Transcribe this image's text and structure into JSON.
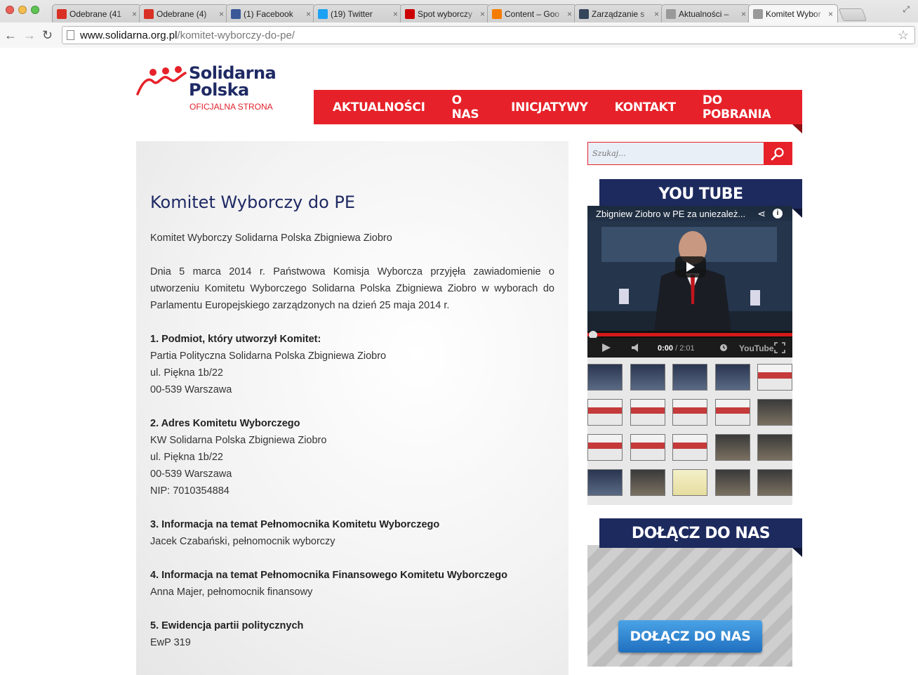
{
  "browser": {
    "tabs": [
      {
        "title": "Odebrane (41",
        "favicon": "gmail-icon",
        "color": "#d93025",
        "active": false
      },
      {
        "title": "Odebrane (4)",
        "favicon": "gmail-icon",
        "color": "#d93025",
        "active": false
      },
      {
        "title": "(1) Facebook",
        "favicon": "facebook-icon",
        "color": "#3b5998",
        "active": false
      },
      {
        "title": "(19) Twitter",
        "favicon": "twitter-icon",
        "color": "#1da1f2",
        "active": false
      },
      {
        "title": "Spot wyborczy",
        "favicon": "youtube-icon",
        "color": "#cc0000",
        "active": false
      },
      {
        "title": "Content – Goo",
        "favicon": "analytics-icon",
        "color": "#f57c00",
        "active": false
      },
      {
        "title": "Zarządzanie s",
        "favicon": "tumblr-icon",
        "color": "#35465c",
        "active": false
      },
      {
        "title": "Aktualności –",
        "favicon": "page-icon",
        "color": "#999999",
        "active": false
      },
      {
        "title": "Komitet Wybor",
        "favicon": "page-icon",
        "color": "#999999",
        "active": true
      }
    ],
    "url_domain": "www.solidarna.org.pl",
    "url_path": "/komitet-wyborczy-do-pe/"
  },
  "site": {
    "logo_line1": "Solidarna",
    "logo_line2": "Polska",
    "logo_tagline": "OFICJALNA STRONA",
    "nav": [
      "AKTUALNOŚCI",
      "O NAS",
      "INICJATYWY",
      "KONTAKT",
      "DO POBRANIA"
    ],
    "accent_color": "#e62129",
    "navy_color": "#1d2a5e"
  },
  "article": {
    "title": "Komitet Wyborczy do PE",
    "intro": "Komitet Wyborczy Solidarna Polska Zbigniewa Ziobro",
    "paragraph": "Dnia 5 marca 2014 r. Państwowa Komisja Wyborcza przyjęła zawiadomienie o utworzeniu Komitetu Wyborczego Solidarna Polska Zbigniewa Ziobro w wyborach do Parlamentu Europejskiego zarządzonych na dzień 25 maja 2014 r.",
    "sections": [
      {
        "heading": "1. Podmiot, który utworzył Komitet:",
        "lines": [
          "Partia Polityczna Solidarna Polska Zbigniewa Ziobro",
          "ul. Piękna 1b/22",
          "00-539 Warszawa"
        ]
      },
      {
        "heading": "2. Adres Komitetu Wyborczego",
        "lines": [
          "KW Solidarna Polska Zbigniewa Ziobro",
          "ul. Piękna 1b/22",
          "00-539 Warszawa",
          "NIP: 7010354884"
        ]
      },
      {
        "heading": "3. Informacja na temat Pełnomocnika Komitetu Wyborczego",
        "lines": [
          "Jacek Czabański, pełnomocnik wyborczy"
        ]
      },
      {
        "heading": "4. Informacja na temat Pełnomocnika Finansowego Komitetu Wyborczego",
        "lines": [
          "Anna Majer, pełnomocnik finansowy"
        ]
      },
      {
        "heading": "5. Ewidencja partii politycznych",
        "lines": [
          "EwP 319"
        ]
      }
    ]
  },
  "sidebar": {
    "search_placeholder": "Szukaj...",
    "youtube_title": "YOU TUBE",
    "video": {
      "title": "Zbigniew Ziobro w PE za uniezależ...",
      "time_current": "0:00",
      "time_total": "/ 2:01",
      "logo": "YouTube"
    },
    "thumbnails": [
      "dark",
      "dark",
      "dark",
      "dark",
      "red",
      "red",
      "red",
      "red",
      "red",
      "hall",
      "red",
      "red",
      "red",
      "hall",
      "hall",
      "dark",
      "hall",
      "sign",
      "hall",
      "hall"
    ],
    "join_title": "DOŁĄCZ DO NAS",
    "join_button": "DOŁĄCZ DO NAS"
  }
}
